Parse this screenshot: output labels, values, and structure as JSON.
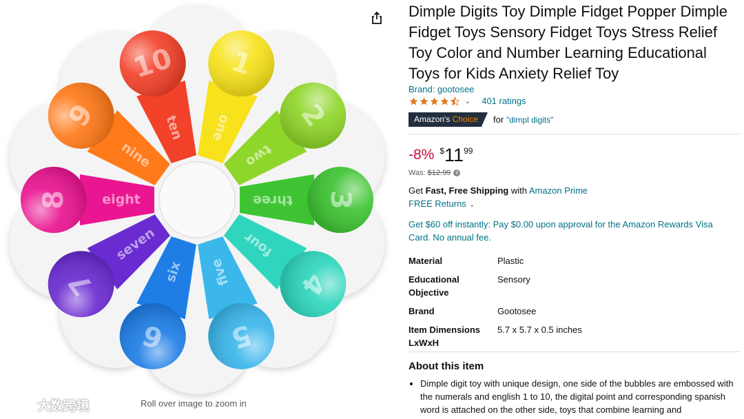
{
  "image_pane": {
    "zoom_hint": "Roll over image to zoom in",
    "watermark": "大数跨境",
    "share_icon": "share-icon",
    "product_image": {
      "numbers": [
        "1",
        "2",
        "3",
        "4",
        "5",
        "6",
        "7",
        "8",
        "9",
        "10"
      ],
      "words": [
        "one",
        "two",
        "three",
        "four",
        "five",
        "six",
        "seven",
        "eight",
        "nine",
        "ten"
      ],
      "colors": [
        "#f7e21b",
        "#8fd62a",
        "#3ec433",
        "#2fd6bd",
        "#3bb7ec",
        "#1e7ee6",
        "#6a2bd0",
        "#ea1591",
        "#ff7a1a",
        "#f2422a"
      ]
    }
  },
  "product": {
    "title": "Dimple Digits Toy Dimple Fidget Popper Dimple Fidget Toys Sensory Fidget Toys Stress Relief Toy Color and Number Learning Educational Toys for Kids Anxiety Relief Toy",
    "brand": "Brand: gootosee",
    "rating_stars": 4.5,
    "rating_count": "401 ratings",
    "badge": {
      "prefix": "Amazon's ",
      "highlight": "Choice"
    },
    "choice_for": "for",
    "choice_keyword": "\"dimpl digits\""
  },
  "pricing": {
    "discount": "-8%",
    "currency": "$",
    "whole": "11",
    "fraction": "99",
    "was_label": "Was:",
    "was_price": "$12.99"
  },
  "shipping": {
    "get": "Get",
    "fast": "Fast, Free Shipping",
    "with": "with",
    "prime": "Amazon Prime",
    "returns": "FREE Returns"
  },
  "promo": "Get $60 off instantly: Pay $0.00 upon approval for the Amazon Rewards Visa Card. No annual fee.",
  "specs": [
    {
      "key": "Material",
      "value": "Plastic"
    },
    {
      "key": "Educational Objective",
      "value": "Sensory"
    },
    {
      "key": "Brand",
      "value": "Gootosee"
    },
    {
      "key": "Item Dimensions LxWxH",
      "value": "5.7 x 5.7 x 0.5 inches"
    }
  ],
  "about": {
    "heading": "About this item",
    "bullets": [
      "Dimple digit toy with unique design, one side of the bubbles are embossed with the numerals and english 1 to 10, the digital point and corresponding spanish word is attached on the other side, toys that combine learning and"
    ]
  },
  "colors": {
    "link": "#007185",
    "discount": "#cc0c39",
    "star": "#de7921",
    "badge_bg": "#232f3e",
    "badge_accent": "#f08804"
  }
}
